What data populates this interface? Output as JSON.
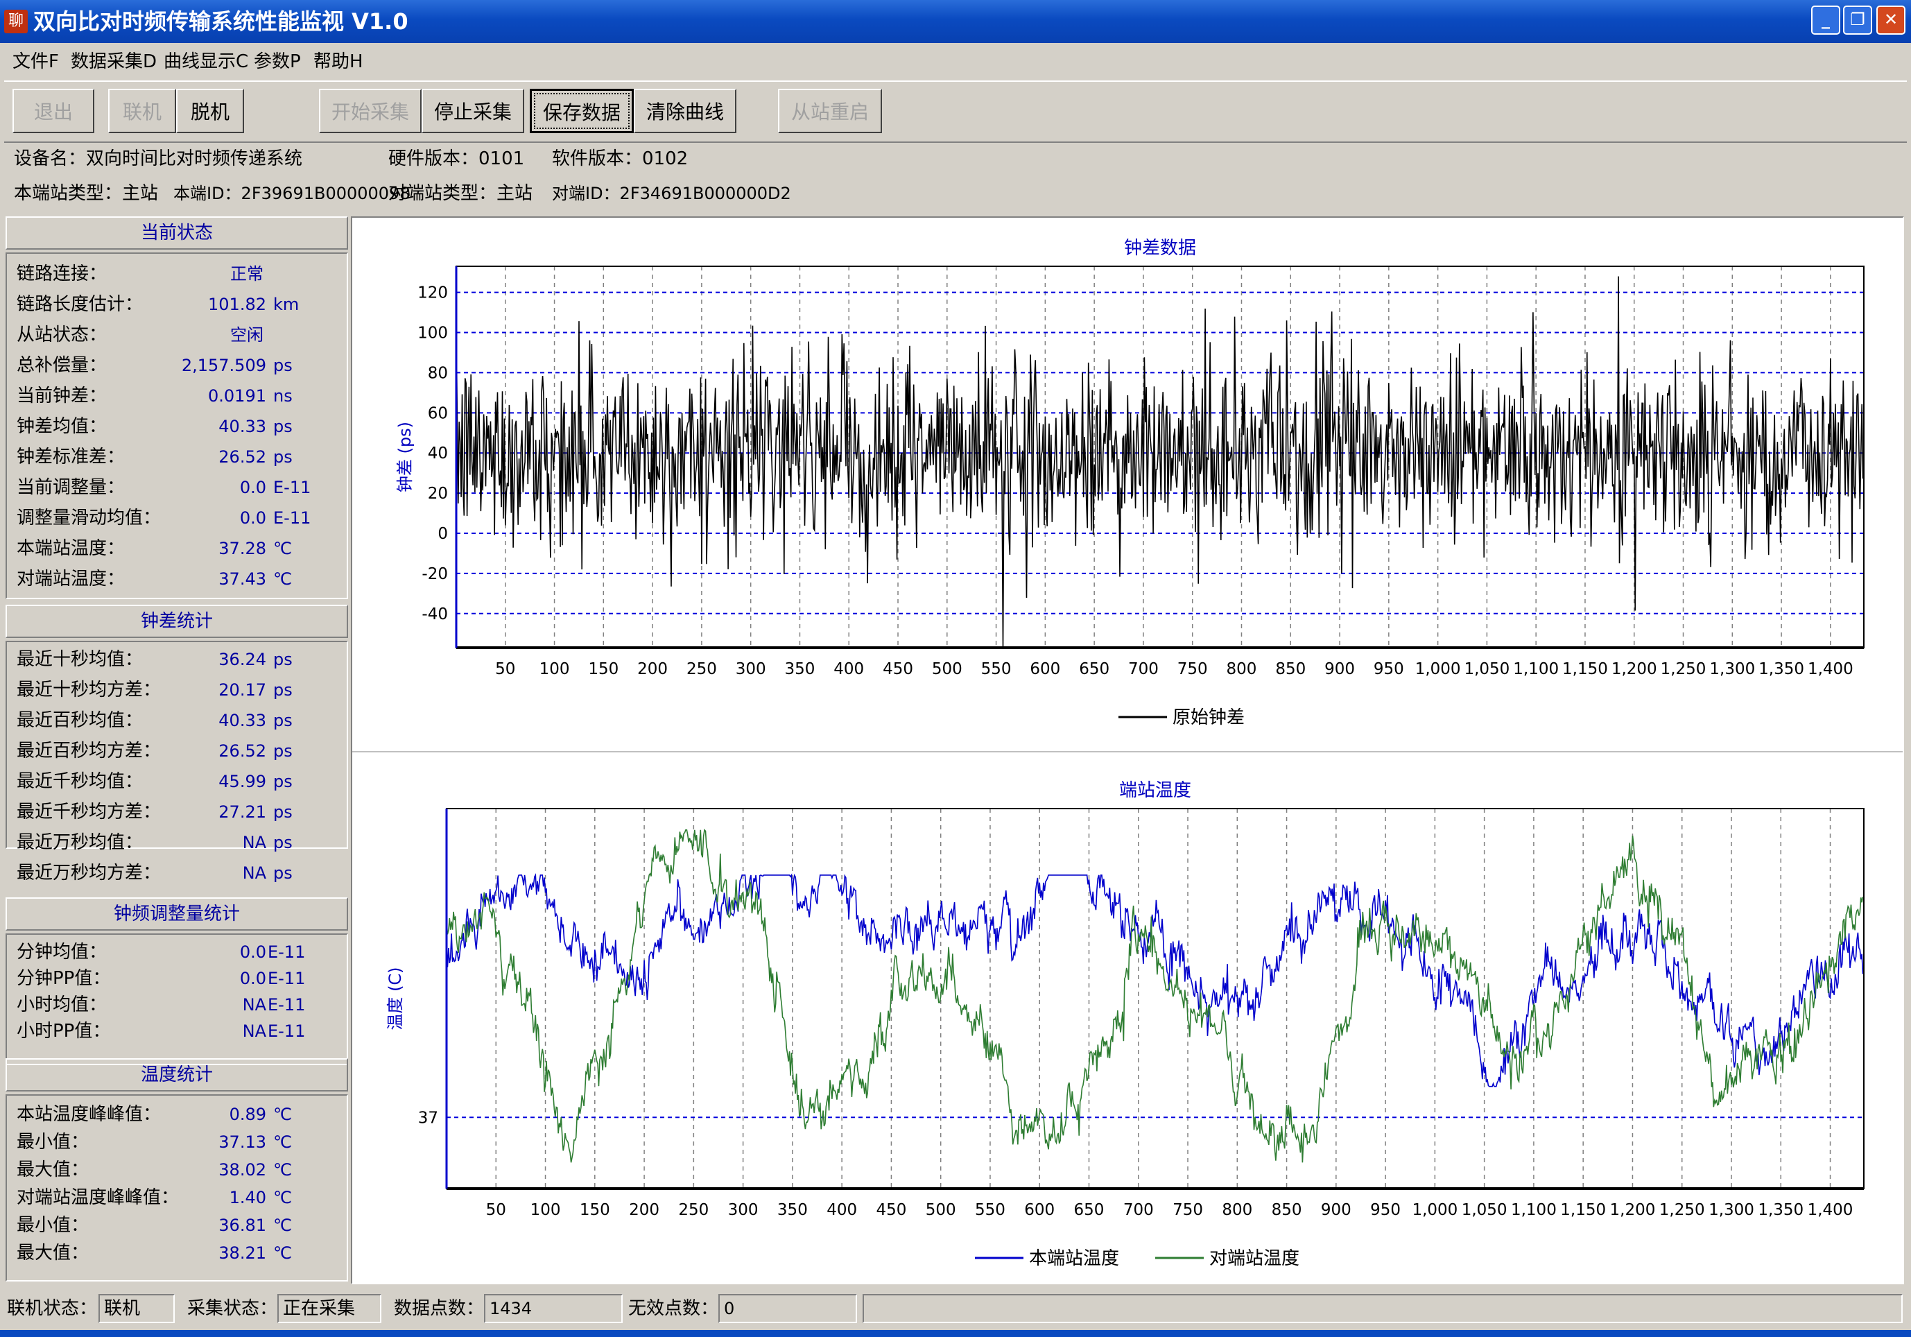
{
  "window": {
    "title": "双向比对时频传输系统性能监视 V1.0",
    "app_icon_glyph": "聊"
  },
  "menu": [
    "文件F",
    "数据采集D",
    "曲线显示C",
    "参数P",
    "帮助H"
  ],
  "toolbar": {
    "exit": "退出",
    "online": "联机",
    "offline": "脱机",
    "start": "开始采集",
    "stop": "停止采集",
    "save": "保存数据",
    "clear": "清除曲线",
    "restart": "从站重启"
  },
  "device": {
    "name": "设备名：双向时间比对时频传递系统",
    "hw_version": "硬件版本：0101",
    "sw_version": "软件版本：0102",
    "local_type": "本端站类型：主站",
    "local_id": "本端ID：2F39691B00000098",
    "remote_type": "对端站类型：主站",
    "remote_id": "对端ID：2F34691B000000D2"
  },
  "sections": {
    "current": {
      "title": "当前状态",
      "rows": [
        {
          "label": "链路连接：",
          "value": "正常",
          "unit": ""
        },
        {
          "label": "链路长度估计：",
          "value": "101.82",
          "unit": "km"
        },
        {
          "label": "从站状态：",
          "value": "空闲",
          "unit": ""
        },
        {
          "label": "总补偿量：",
          "value": "2,157.509",
          "unit": "ps"
        },
        {
          "label": "当前钟差：",
          "value": "0.0191",
          "unit": "ns"
        },
        {
          "label": "钟差均值：",
          "value": "40.33",
          "unit": "ps"
        },
        {
          "label": "钟差标准差：",
          "value": "26.52",
          "unit": "ps"
        },
        {
          "label": "当前调整量：",
          "value": "0.0",
          "unit": "E-11"
        },
        {
          "label": "调整量滑动均值：",
          "value": "0.0",
          "unit": "E-11"
        },
        {
          "label": "本端站温度：",
          "value": "37.28",
          "unit": "℃"
        },
        {
          "label": "对端站温度：",
          "value": "37.43",
          "unit": "℃"
        }
      ]
    },
    "clock": {
      "title": "钟差统计",
      "rows": [
        {
          "label": "最近十秒均值：",
          "value": "36.24",
          "unit": "ps"
        },
        {
          "label": "最近十秒均方差：",
          "value": "20.17",
          "unit": "ps"
        },
        {
          "label": "最近百秒均值：",
          "value": "40.33",
          "unit": "ps"
        },
        {
          "label": "最近百秒均方差：",
          "value": "26.52",
          "unit": "ps"
        },
        {
          "label": "最近千秒均值：",
          "value": "45.99",
          "unit": "ps"
        },
        {
          "label": "最近千秒均方差：",
          "value": "27.21",
          "unit": "ps"
        },
        {
          "label": "最近万秒均值：",
          "value": "NA",
          "unit": "ps"
        },
        {
          "label": "最近万秒均方差：",
          "value": "NA",
          "unit": "ps"
        }
      ]
    },
    "adjust": {
      "title": "钟频调整量统计",
      "rows": [
        {
          "label": "分钟均值：",
          "value": "0.0",
          "unit": "E-11"
        },
        {
          "label": "分钟PP值：",
          "value": "0.0",
          "unit": "E-11"
        },
        {
          "label": "小时均值：",
          "value": "NA",
          "unit": "E-11"
        },
        {
          "label": "小时PP值：",
          "value": "NA",
          "unit": "E-11"
        }
      ]
    },
    "temp": {
      "title": "温度统计",
      "rows": [
        {
          "label": "本站温度峰峰值：",
          "value": "0.89",
          "unit": "℃"
        },
        {
          "label": "最小值：",
          "value": "37.13",
          "unit": "℃"
        },
        {
          "label": "最大值：",
          "value": "38.02",
          "unit": "℃"
        },
        {
          "label": "对端站温度峰峰值：",
          "value": "1.40",
          "unit": "℃"
        },
        {
          "label": "最小值：",
          "value": "36.81",
          "unit": "℃"
        },
        {
          "label": "最大值：",
          "value": "38.21",
          "unit": "℃"
        }
      ]
    }
  },
  "status": {
    "conn_label": "联机状态：",
    "conn_value": "联机",
    "acq_label": "采集状态：",
    "acq_value": "正在采集",
    "points_label": "数据点数：",
    "points_value": "1434",
    "invalid_label": "无效点数：",
    "invalid_value": "0"
  },
  "chart_data": [
    {
      "type": "line",
      "title": "钟差数据",
      "ylabel": "钟差 (ps)",
      "xlabel": "",
      "xlim": [
        0,
        1434
      ],
      "ylim": [
        -57,
        133
      ],
      "yticks": [
        -40,
        -20,
        0,
        20,
        40,
        60,
        80,
        100,
        120
      ],
      "xticks": [
        50,
        100,
        150,
        200,
        250,
        300,
        350,
        400,
        450,
        500,
        550,
        600,
        650,
        700,
        750,
        800,
        850,
        900,
        950,
        1000,
        1050,
        1100,
        1150,
        1200,
        1250,
        1300,
        1350,
        1400
      ],
      "xtick_labels": [
        "50",
        "100",
        "150",
        "200",
        "250",
        "300",
        "350",
        "400",
        "450",
        "500",
        "550",
        "600",
        "650",
        "700",
        "750",
        "800",
        "850",
        "900",
        "950",
        "1,000",
        "1,050",
        "1,100",
        "1,150",
        "1,200",
        "1,250",
        "1,300",
        "1,350",
        "1,400"
      ],
      "grid": true,
      "legend": "bottom-center",
      "series": [
        {
          "name": "原始钟差",
          "color": "#000000",
          "n_points": 1434,
          "mean": 40.33,
          "std": 26.52,
          "min": -57,
          "max": 132
        }
      ]
    },
    {
      "type": "line",
      "title": "端站温度",
      "ylabel": "温度 (C)",
      "xlabel": "",
      "xlim": [
        0,
        1434
      ],
      "ylim": [
        36.7,
        38.3
      ],
      "yticks": [
        37
      ],
      "xticks": [
        50,
        100,
        150,
        200,
        250,
        300,
        350,
        400,
        450,
        500,
        550,
        600,
        650,
        700,
        750,
        800,
        850,
        900,
        950,
        1000,
        1050,
        1100,
        1150,
        1200,
        1250,
        1300,
        1350,
        1400
      ],
      "xtick_labels": [
        "50",
        "100",
        "150",
        "200",
        "250",
        "300",
        "350",
        "400",
        "450",
        "500",
        "550",
        "600",
        "650",
        "700",
        "750",
        "800",
        "850",
        "900",
        "950",
        "1,000",
        "1,050",
        "1,100",
        "1,150",
        "1,200",
        "1,250",
        "1,300",
        "1,350",
        "1,400"
      ],
      "grid": true,
      "legend": "bottom-center",
      "series": [
        {
          "name": "本端站温度",
          "color": "#0000cc",
          "n_points": 1434,
          "min": 37.13,
          "max": 38.02
        },
        {
          "name": "对端站温度",
          "color": "#2e7d32",
          "n_points": 1434,
          "min": 36.81,
          "max": 38.21
        }
      ]
    }
  ]
}
